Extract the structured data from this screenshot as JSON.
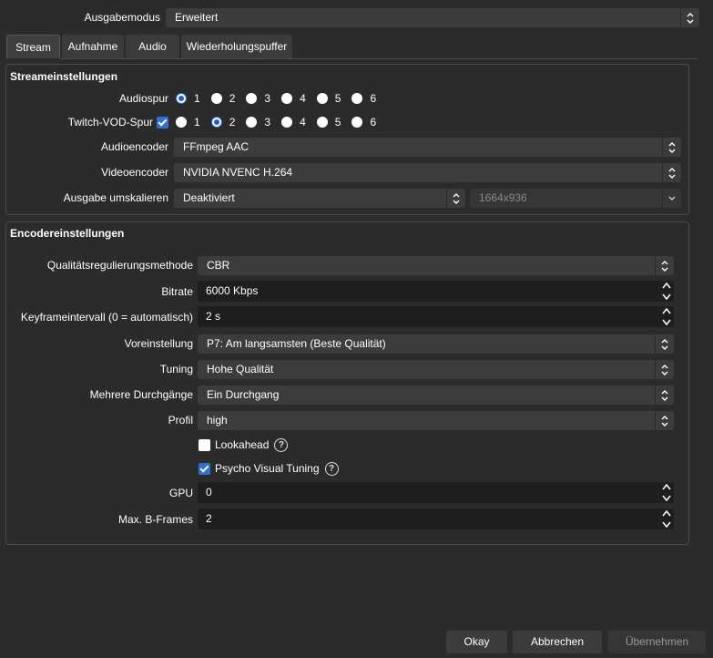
{
  "output_mode": {
    "label": "Ausgabemodus",
    "value": "Erweitert"
  },
  "tabs": [
    {
      "label": "Stream",
      "active": true
    },
    {
      "label": "Aufnahme",
      "active": false
    },
    {
      "label": "Audio",
      "active": false
    },
    {
      "label": "Wiederholungspuffer",
      "active": false
    }
  ],
  "stream_settings": {
    "title": "Streameinstellungen",
    "audio_track": {
      "label": "Audiospur",
      "options": [
        "1",
        "2",
        "3",
        "4",
        "5",
        "6"
      ],
      "selected": "1"
    },
    "twitch_vod_track": {
      "label": "Twitch-VOD-Spur",
      "checked": true,
      "options": [
        "1",
        "2",
        "3",
        "4",
        "5",
        "6"
      ],
      "selected": "2"
    },
    "audio_encoder": {
      "label": "Audioencoder",
      "value": "FFmpeg AAC"
    },
    "video_encoder": {
      "label": "Videoencoder",
      "value": "NVIDIA NVENC H.264"
    },
    "rescale": {
      "label": "Ausgabe umskalieren",
      "value": "Deaktiviert",
      "resolution": "1664x936"
    }
  },
  "encoder_settings": {
    "title": "Encodereinstellungen",
    "rate_control": {
      "label": "Qualitätsregulierungsmethode",
      "value": "CBR"
    },
    "bitrate": {
      "label": "Bitrate",
      "value": "6000 Kbps"
    },
    "keyframe": {
      "label": "Keyframeintervall (0 = automatisch)",
      "value": "2 s"
    },
    "preset": {
      "label": "Voreinstellung",
      "value": "P7: Am langsamsten (Beste Qualität)"
    },
    "tuning": {
      "label": "Tuning",
      "value": "Hohe Qualität"
    },
    "multipass": {
      "label": "Mehrere Durchgänge",
      "value": "Ein Durchgang"
    },
    "profile": {
      "label": "Profil",
      "value": "high"
    },
    "lookahead": {
      "label": "Lookahead",
      "checked": false
    },
    "psycho_visual": {
      "label": "Psycho Visual Tuning",
      "checked": true
    },
    "gpu": {
      "label": "GPU",
      "value": "0"
    },
    "bframes": {
      "label": "Max. B-Frames",
      "value": "2"
    }
  },
  "buttons": {
    "ok": "Okay",
    "cancel": "Abbrechen",
    "apply": "Übernehmen"
  },
  "colors": {
    "background": "#2b2b2b",
    "field": "#3c3c3c",
    "spin_field": "#1e1e1e",
    "accent": "#2f6fd6"
  }
}
